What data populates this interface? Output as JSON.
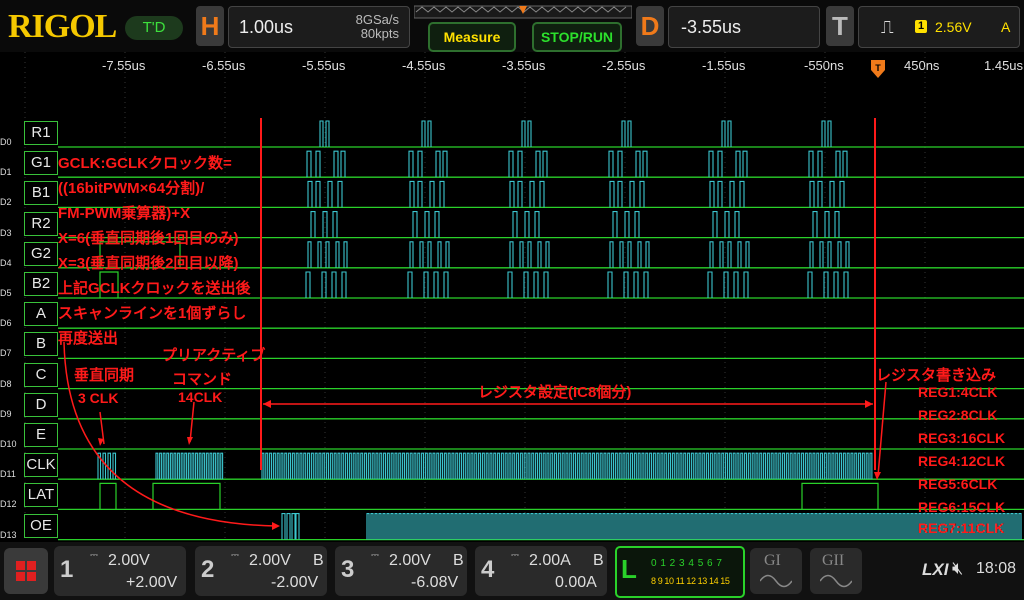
{
  "brand": "RIGOL",
  "trigger_mode": "T'D",
  "horizontal": {
    "letter": "H",
    "timebase": "1.00us",
    "sample_rate": "8GSa/s",
    "memory_depth": "80kpts"
  },
  "buttons": {
    "measure": "Measure",
    "stop_run": "STOP/RUN"
  },
  "delay": {
    "letter": "D",
    "value": "-3.55us"
  },
  "trigger": {
    "letter": "T",
    "source_badge": "1",
    "level": "2.56V",
    "mode": "A"
  },
  "time_ticks": [
    "-7.55us",
    "-6.55us",
    "-5.55us",
    "-4.55us",
    "-3.55us",
    "-2.55us",
    "-1.55us",
    "-550ns",
    "450ns",
    "1.45us"
  ],
  "channels": [
    {
      "id": "D0",
      "label": "R1"
    },
    {
      "id": "D1",
      "label": "G1"
    },
    {
      "id": "D2",
      "label": "B1"
    },
    {
      "id": "D3",
      "label": "R2"
    },
    {
      "id": "D4",
      "label": "G2"
    },
    {
      "id": "D5",
      "label": "B2"
    },
    {
      "id": "D6",
      "label": "A"
    },
    {
      "id": "D7",
      "label": "B"
    },
    {
      "id": "D8",
      "label": "C"
    },
    {
      "id": "D9",
      "label": "D"
    },
    {
      "id": "D10",
      "label": "E"
    },
    {
      "id": "D11",
      "label": "CLK"
    },
    {
      "id": "D12",
      "label": "LAT"
    },
    {
      "id": "D13",
      "label": "OE"
    }
  ],
  "annotations": {
    "gclk_lines": [
      "GCLK:GCLKクロック数=",
      "((16bitPWM×64分割)/",
      "FM-PWM乗算器)+X",
      "X=6(垂直同期後1回目のみ)",
      "X=3(垂直同期後2回目以降)",
      "上記GCLKクロックを送出後",
      "スキャンラインを1個ずらし",
      "再度送出"
    ],
    "vsync_title": "垂直同期",
    "vsync_clk": "3 CLK",
    "preactive_title": "プリアクティブ",
    "preactive_cmd": "コマンド",
    "preactive_clk": "14CLK",
    "register_setting": "レジスタ設定(IC8個分)",
    "register_write": "レジスタ書き込み",
    "regs": [
      "REG1:4CLK",
      "REG2:8CLK",
      "REG3:16CLK",
      "REG4:12CLK",
      "REG5:6CLK",
      "REG6:15CLK",
      "REG7:11CLK"
    ]
  },
  "analog_channels": [
    {
      "num": "1",
      "scale": "2.00V",
      "tag": "",
      "offset": "+2.00V"
    },
    {
      "num": "2",
      "scale": "2.00V",
      "tag": "B",
      "offset": "-2.00V"
    },
    {
      "num": "3",
      "scale": "2.00V",
      "tag": "B",
      "offset": "-6.08V"
    },
    {
      "num": "4",
      "scale": "2.00A",
      "tag": "B",
      "offset": "0.00A"
    }
  ],
  "logic": {
    "letter": "L",
    "row1": "0 1 2 3 4 5 6 7",
    "row2": "8 9 10 11 12 13 14 15"
  },
  "generators": [
    "GI",
    "GII"
  ],
  "lxi": "LXI",
  "clock": "18:08",
  "colors": {
    "trace_low": "#2ad12a",
    "trace_pulse": "#3cc6cf",
    "annotation": "#ff1a1a",
    "brand": "#f5c800"
  }
}
